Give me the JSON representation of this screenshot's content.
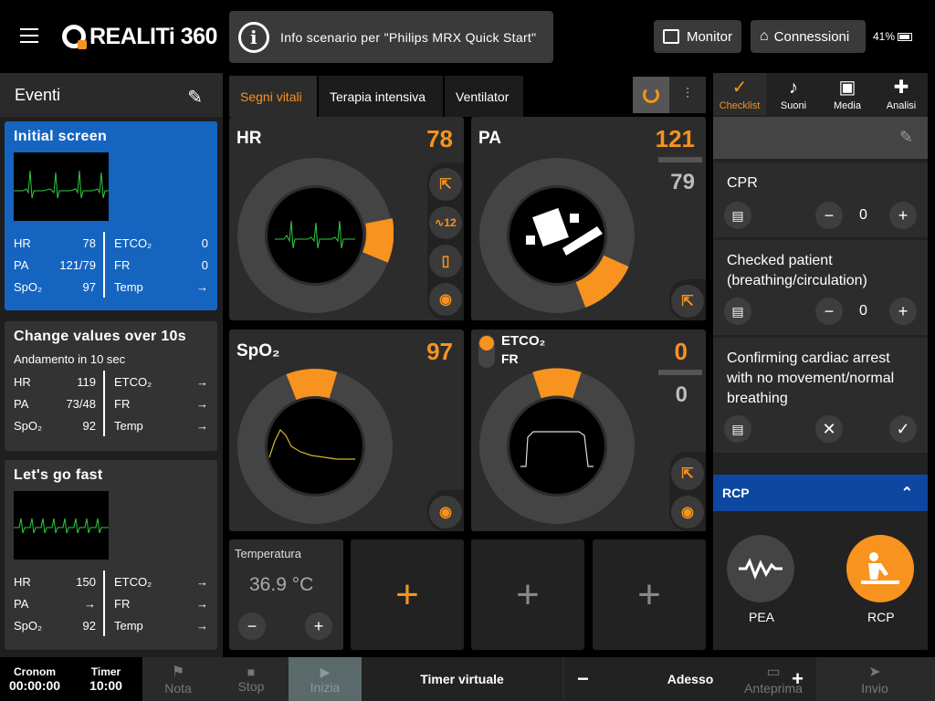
{
  "header": {
    "logo_text": "REALITi 360",
    "info_text": "Info scenario per  \"Philips MRX Quick Start\"",
    "monitor_label": "Monitor",
    "connections_label": "Connessioni",
    "battery": "41%"
  },
  "events": {
    "title": "Eventi",
    "cards": [
      {
        "title": "Initial screen",
        "hr": "78",
        "pa": "121/79",
        "spo2": "97",
        "etco2": "0",
        "fr": "0",
        "temp": "→"
      },
      {
        "title": "Change values over 10s",
        "subtitle": "Andamento in 10 sec",
        "hr": "119",
        "pa": "73/48",
        "spo2": "92",
        "etco2": "→",
        "fr": "→",
        "temp": "→"
      },
      {
        "title": "Let's go fast",
        "hr": "150",
        "pa": "→",
        "spo2": "92",
        "etco2": "→",
        "fr": "→",
        "temp": "→"
      }
    ],
    "labels": {
      "hr": "HR",
      "pa": "PA",
      "spo2": "SpO₂",
      "etco2": "ETCO₂",
      "fr": "FR",
      "temp": "Temp"
    }
  },
  "tabs": [
    "Segni vitali",
    "Terapia intensiva",
    "Ventilator"
  ],
  "vitals": {
    "hr": {
      "label": "HR",
      "value": "78"
    },
    "pa": {
      "label": "PA",
      "sys": "121",
      "dia": "79"
    },
    "spo2": {
      "label": "SpO₂",
      "value": "97"
    },
    "etco2": {
      "label1": "ETCO₂",
      "label2": "FR",
      "value1": "0",
      "value2": "0"
    },
    "temp": {
      "label": "Temperatura",
      "value": "36.9 °C",
      "minus": "−",
      "plus": "+"
    }
  },
  "right_tabs": [
    "Checklist",
    "Suoni",
    "Media",
    "Analisi"
  ],
  "checklist": [
    {
      "text": "CPR",
      "count": "0"
    },
    {
      "text": "Checked patient (breathing/circulation)",
      "count": "0"
    },
    {
      "text": "Confirming cardiac arrest with no movement/normal breathing"
    }
  ],
  "rcp": {
    "title": "RCP",
    "pea_label": "PEA",
    "rcp_label": "RCP"
  },
  "footer": {
    "cronom_label": "Cronom",
    "cronom_value": "00:00:00",
    "timer_label": "Timer",
    "timer_value": "10:00",
    "nota": "Nota",
    "stop": "Stop",
    "inizia": "Inizia",
    "virtual_timer": "Timer virtuale",
    "minus": "−",
    "now": "Adesso",
    "plus": "+",
    "preview": "Anteprima",
    "send": "Invio"
  }
}
